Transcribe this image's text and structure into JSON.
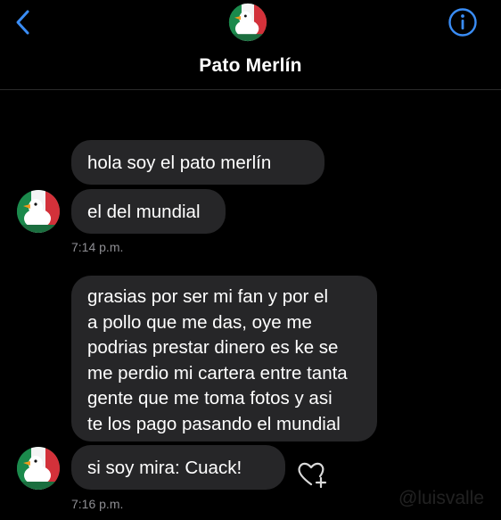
{
  "header": {
    "contact_name": "Pato Merlín",
    "back_icon": "chevron-left-icon",
    "info_icon": "info-circle-icon"
  },
  "messages": [
    {
      "text": "hola soy el pato merlín"
    },
    {
      "text": "el del mundial"
    },
    {
      "text": "grasias por ser mi fan y por el\na pollo que me das, oye me\npodrias prestar dinero es ke se\nme perdio mi cartera entre tanta\ngente que me toma fotos y asi\nte los pago pasando el mundial"
    },
    {
      "text": "si soy mira:  Cuack!"
    }
  ],
  "timestamps": [
    "7:14 p.m.",
    "7:16 p.m."
  ],
  "watermark": "@luisvalle",
  "colors": {
    "accent": "#3a8df6",
    "bubble": "#262628",
    "timestamp": "#8e8e93",
    "background": "#000000"
  }
}
